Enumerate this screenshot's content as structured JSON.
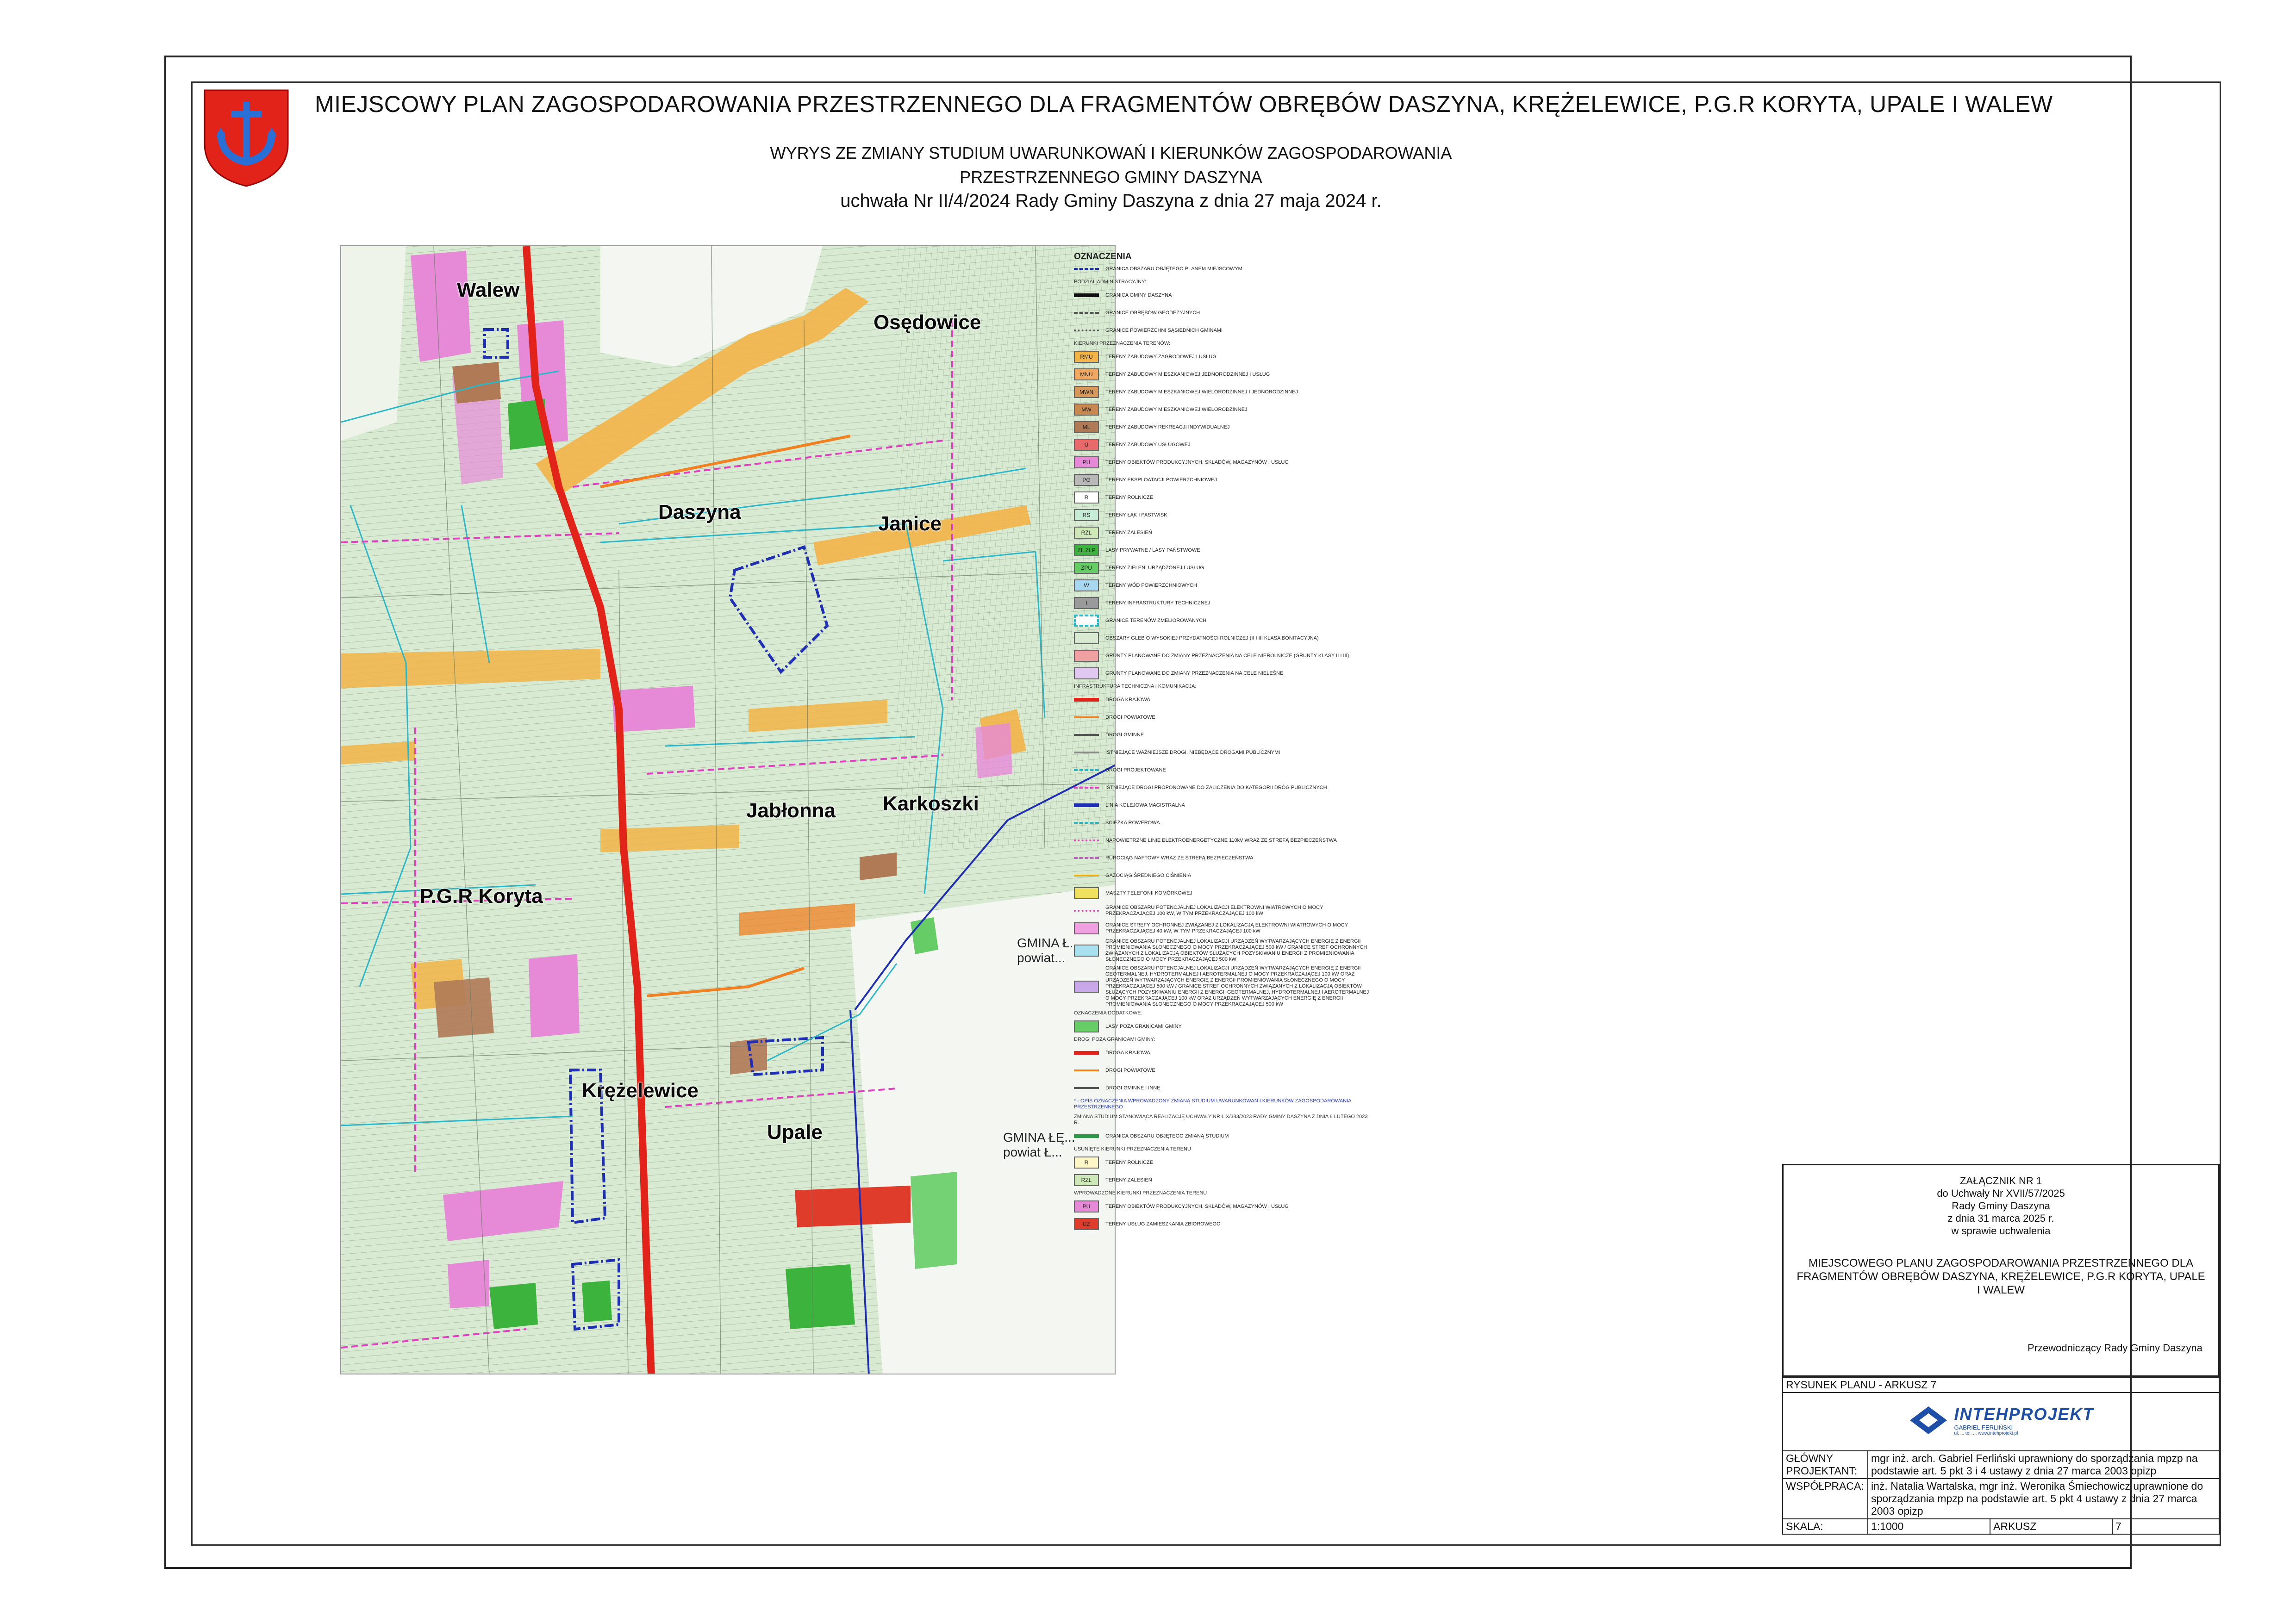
{
  "header": {
    "main_title": "MIEJSCOWY PLAN ZAGOSPODAROWANIA PRZESTRZENNEGO DLA FRAGMENTÓW OBRĘBÓW DASZYNA, KRĘŻELEWICE, P.G.R KORYTA, UPALE I WALEW",
    "subtitle_1": "WYRYS ZE ZMIANY STUDIUM UWARUNKOWAŃ I KIERUNKÓW ZAGOSPODAROWANIA",
    "subtitle_2": "PRZESTRZENNEGO GMINY DASZYNA",
    "subtitle_3": "uchwała Nr II/4/2024 Rady Gminy Daszyna z dnia 27 maja 2024 r."
  },
  "map": {
    "place_labels": {
      "walew": "Walew",
      "osedowice": "Osędowice",
      "daszyna": "Daszyna",
      "janice": "Janice",
      "jablonna": "Jabłonna",
      "karkoszki": "Karkoszki",
      "pgr_koryta": "P.G.R Koryta",
      "krezelewice": "Krężelewice",
      "upale": "Upale",
      "gmina_powiat_1": "GMINA Ł... powiat...",
      "gmina_powiat_2": "GMINA ŁĘ... powiat Ł..."
    },
    "colors": {
      "base_green": "#d9ead3",
      "road_red": "#e2231a",
      "orange_zone": "#f2b447",
      "magenta_zone": "#e68ad8",
      "brown_zone": "#b07a57",
      "forest_green": "#3cb33c",
      "red_zone": "#e03c2b",
      "blue_boundary": "#1f2fb5",
      "cyan_line": "#2ab7c9",
      "pink_dash": "#e040c0"
    }
  },
  "legend": {
    "title": "OZNACZENIA",
    "sections": [
      {
        "heading": "",
        "items": [
          {
            "code": "",
            "label": "GRANICA OBSZARU OBJĘTEGO PLANEM MIEJSCOWYM",
            "color": "#1f2fb5",
            "style": "dash"
          }
        ]
      },
      {
        "heading": "PODZIAŁ ADMINISTRACYJNY:",
        "items": [
          {
            "code": "",
            "label": "GRANICA GMINY DASZYNA",
            "color": "#111111",
            "style": "thick"
          },
          {
            "code": "",
            "label": "GRANICE OBRĘBÓW GEODEZYJNYCH",
            "color": "#555555",
            "style": "dash"
          },
          {
            "code": "",
            "label": "GRANICE POWIERZCHNI SĄSIEDNICH GMINAMI",
            "color": "#555555",
            "style": "dashdot"
          }
        ]
      },
      {
        "heading": "KIERUNKI PRZEZNACZENIA TERENÓW:",
        "items": [
          {
            "code": "RMU",
            "label": "TERENY ZABUDOWY ZAGRODOWEJ I USŁUG",
            "color": "#f2b447",
            "style": "fill"
          },
          {
            "code": "MNU",
            "label": "TERENY ZABUDOWY MIESZKANIOWEJ JEDNORODZINNEJ I USŁUG",
            "color": "#f0a860",
            "style": "fill"
          },
          {
            "code": "MWN",
            "label": "TERENY ZABUDOWY MIESZKANIOWEJ WIELORODZINNEJ I JEDNORODZINNEJ",
            "color": "#d8985a",
            "style": "fill"
          },
          {
            "code": "MW",
            "label": "TERENY ZABUDOWY MIESZKANIOWEJ WIELORODZINNEJ",
            "color": "#c88850",
            "style": "fill"
          },
          {
            "code": "ML",
            "label": "TERENY ZABUDOWY REKREACJI INDYWIDUALNEJ",
            "color": "#b07a57",
            "style": "fill"
          },
          {
            "code": "U",
            "label": "TERENY ZABUDOWY USŁUGOWEJ",
            "color": "#e86a6a",
            "style": "fill"
          },
          {
            "code": "PU",
            "label": "TERENY OBIEKTÓW PRODUKCYJNYCH, SKŁADÓW, MAGAZYNÓW I USŁUG",
            "color": "#e68ad8",
            "style": "fill"
          },
          {
            "code": "PG",
            "label": "TERENY EKSPLOATACJI POWIERZCHNIOWEJ",
            "color": "#b8b8b8",
            "style": "fill"
          },
          {
            "code": "R",
            "label": "TERENY ROLNICZE",
            "color": "#ffffff",
            "style": "fill"
          },
          {
            "code": "RS",
            "label": "TERENY ŁĄK I PASTWISK",
            "color": "#c6ecd6",
            "style": "fill"
          },
          {
            "code": "RZL",
            "label": "TERENY ZALESIEŃ",
            "color": "#cfe8b8",
            "style": "fill"
          },
          {
            "code": "ZL ZLP",
            "label": "LASY PRYWATNE / LASY PAŃSTWOWE",
            "color": "#3cb33c",
            "style": "fill"
          },
          {
            "code": "ZPU",
            "label": "TERENY ZIELENI URZĄDZONEJ I USŁUG",
            "color": "#66cc66",
            "style": "fill"
          },
          {
            "code": "W",
            "label": "TERENY WÓD POWIERZCHNIOWYCH",
            "color": "#a8d8f0",
            "style": "fill"
          },
          {
            "code": "I",
            "label": "TERENY INFRASTRUKTURY TECHNICZNEJ",
            "color": "#9a9a9a",
            "style": "fill"
          },
          {
            "code": "",
            "label": "GRANICE TERENÓW ZMELIOROWANYCH",
            "color": "#2ab7c9",
            "style": "outline"
          },
          {
            "code": "",
            "label": "OBSZARY GLEB O WYSOKIEJ PRZYDATNOŚCI ROLNICZEJ (II I III KLASA BONITACYJNA)",
            "color": "#d9ead3",
            "style": "fill"
          },
          {
            "code": "",
            "label": "GRUNTY PLANOWANE DO ZMIANY PRZEZNACZENIA NA CELE NIEROLNICZE (GRUNTY KLASY II I III)",
            "color": "#f0a0a0",
            "style": "fill"
          },
          {
            "code": "",
            "label": "GRUNTY PLANOWANE DO ZMIANY PRZEZNACZENIA NA CELE NIELEŚNE",
            "color": "#e0c8f0",
            "style": "fill"
          }
        ]
      },
      {
        "heading": "INFRASTRUKTURA TECHNICZNA I KOMUNIKACJA:",
        "items": [
          {
            "code": "",
            "label": "DROGA KRAJOWA",
            "color": "#e2231a",
            "style": "thick"
          },
          {
            "code": "",
            "label": "DROGI POWIATOWE",
            "color": "#f08020",
            "style": "line"
          },
          {
            "code": "",
            "label": "DROGI GMINNE",
            "color": "#555555",
            "style": "line"
          },
          {
            "code": "",
            "label": "ISTNIEJĄCE WAŻNIEJSZE DROGI, NIEBĘDĄCE DROGAMI PUBLICZNYMI",
            "color": "#888888",
            "style": "line"
          },
          {
            "code": "",
            "label": "DROGI PROJEKTOWANE",
            "color": "#2ab7c9",
            "style": "dash"
          },
          {
            "code": "",
            "label": "ISTNIEJĄCE DROGI PROPONOWANE DO ZALICZENIA DO KATEGORII DRÓG PUBLICZNYCH",
            "color": "#e040c0",
            "style": "dash"
          },
          {
            "code": "",
            "label": "LINIA KOLEJOWA MAGISTRALNA",
            "color": "#1f2fb5",
            "style": "thick"
          },
          {
            "code": "",
            "label": "ŚCIEŻKA ROWEROWA",
            "color": "#2ab7c9",
            "style": "dash"
          },
          {
            "code": "",
            "label": "NAPOWIETRZNE LINIE ELEKTROENERGETYCZNE 110kV WRAZ ZE STREFĄ BEZPIECZEŃSTWA",
            "color": "#e040c0",
            "style": "dashdot"
          },
          {
            "code": "",
            "label": "RUROCIĄG NAFTOWY WRAZ ZE STREFĄ BEZPIECZEŃSTWA",
            "color": "#c060c0",
            "style": "dash"
          },
          {
            "code": "",
            "label": "GAZOCIĄG ŚREDNIEGO CIŚNIENIA",
            "color": "#e0b020",
            "style": "line"
          },
          {
            "code": "",
            "label": "MASZTY TELEFONII KOMÓRKOWEJ",
            "color": "#f0e060",
            "style": "fill"
          },
          {
            "code": "",
            "label": "GRANICE OBSZARU POTENCJALNEJ LOKALIZACJI ELEKTROWNI WIATROWYCH O MOCY PRZEKRACZAJĄCEJ 100 kW, W TYM PRZEKRACZAJĄCEJ 100 kW",
            "color": "#e040c0",
            "style": "dashdot"
          },
          {
            "code": "",
            "label": "GRANICE STREFY OCHRONNEJ ZWIĄZANEJ Z LOKALIZACJĄ ELEKTROWNI WIATROWYCH O MOCY PRZEKRACZAJĄCEJ 40 kW, W TYM PRZEKRACZAJĄCEJ 100 kW",
            "color": "#f0a0e0",
            "style": "fill"
          },
          {
            "code": "",
            "label": "GRANICE OBSZARU POTENCJALNEJ LOKALIZACJI URZĄDZEŃ WYTWARZAJĄCYCH ENERGIĘ Z ENERGII PROMIENIOWANIA SŁONECZNEGO O MOCY PRZEKRACZAJĄCEJ 500 kW / GRANICE STREF OCHRONNYCH ZWIĄZANYCH Z LOKALIZACJĄ OBIEKTÓW SŁUŻĄCYCH POZYSKIWANIU ENERGII Z PROMIENIOWANIA SŁONECZNEGO O MOCY PRZEKRACZAJĄCEJ 500 kW",
            "color": "#a8e0f0",
            "style": "fill"
          },
          {
            "code": "",
            "label": "GRANICE OBSZARU POTENCJALNEJ LOKALIZACJI URZĄDZEŃ WYTWARZAJĄCYCH ENERGIĘ Z ENERGII GEOTERMALNEJ, HYDROTERMALNEJ I AEROTERMALNEJ O MOCY PRZEKRACZAJĄCEJ 100 kW ORAZ URZĄDZEŃ WYTWARZAJĄCYCH ENERGIĘ Z ENERGII PROMIENIOWANIA SŁONECZNEGO O MOCY PRZEKRACZAJĄCEJ 500 kW / GRANICE STREF OCHRONNYCH ZWIĄZANYCH Z LOKALIZACJĄ OBIEKTÓW SŁUŻĄCYCH POZYSKIWANIU ENERGII Z ENERGII GEOTERMALNEJ, HYDROTERMALNEJ I AEROTERMALNEJ O MOCY PRZEKRACZAJĄCEJ 100 kW ORAZ URZĄDZEŃ WYTWARZAJĄCYCH ENERGIĘ Z ENERGII PROMIENIOWANIA SŁONECZNEGO O MOCY PRZEKRACZAJĄCEJ 500 kW",
            "color": "#c8a8e8",
            "style": "fill"
          }
        ]
      },
      {
        "heading": "OZNACZENIA DODATKOWE:",
        "items": [
          {
            "code": "",
            "label": "LASY POZA GRANICAMI GMINY",
            "color": "#66cc66",
            "style": "fill"
          }
        ]
      },
      {
        "heading": "DROGI POZA GRANICAMI GMINY:",
        "items": [
          {
            "code": "",
            "label": "DROGA KRAJOWA",
            "color": "#e2231a",
            "style": "thick"
          },
          {
            "code": "",
            "label": "DROGI POWIATOWE",
            "color": "#f08020",
            "style": "line"
          },
          {
            "code": "",
            "label": "DROGI GMINNE I INNE",
            "color": "#555555",
            "style": "line"
          }
        ]
      }
    ],
    "note": "* - OPIS OZNACZENIA WPROWADZONY ZMIANĄ STUDIUM UWARUNKOWAŃ I KIERUNKÓW ZAGOSPODAROWANIA PRZESTRZENNEGO",
    "sections_2": [
      {
        "heading": "ZMIANA STUDIUM STANOWIĄCA REALIZACJĘ UCHWAŁY NR LIX/383/2023 RADY GMINY DASZYNA Z DNIA 8 LUTEGO 2023 R.",
        "items": [
          {
            "code": "",
            "label": "GRANICA OBSZARU OBJĘTEGO ZMIANĄ STUDIUM",
            "color": "#2e9a4a",
            "style": "thick"
          }
        ]
      },
      {
        "heading": "USUNIĘTE KIERUNKI PRZEZNACZENIA TERENU",
        "items": [
          {
            "code": "R",
            "label": "TERENY ROLNICZE",
            "color": "#fff6c8",
            "style": "fill"
          },
          {
            "code": "RZL",
            "label": "TERENY ZALESIEŃ",
            "color": "#cfe8b8",
            "style": "fill"
          }
        ]
      },
      {
        "heading": "WPROWADZONE KIERUNKI PRZEZNACZENIA TERENU",
        "items": [
          {
            "code": "PU",
            "label": "TERENY OBIEKTÓW PRODUKCYJNYCH, SKŁADÓW, MAGAZYNÓW I USŁUG",
            "color": "#e68ad8",
            "style": "fill"
          },
          {
            "code": "UZ",
            "label": "TERENY USŁUG ZAMIESZKANIA ZBIOROWEGO",
            "color": "#e03c2b",
            "style": "fill"
          }
        ]
      }
    ]
  },
  "title_block": {
    "zalacznik": [
      "ZAŁĄCZNIK NR 1",
      "do Uchwały Nr XVII/57/2025",
      "Rady Gminy Daszyna",
      "z dnia 31 marca 2025 r.",
      "w sprawie uchwalenia"
    ],
    "plan_title": "MIEJSCOWEGO PLANU ZAGOSPODAROWANIA PRZESTRZENNEGO DLA FRAGMENTÓW OBRĘBÓW DASZYNA, KRĘŻELEWICE, P.G.R KORYTA, UPALE I WALEW",
    "chair": "Przewodniczący Rady Gminy Daszyna",
    "sheet_label": "RYSUNEK PLANU - ARKUSZ 7",
    "logo_name": "INTEHPROJEKT",
    "logo_sub": "GABRIEL FERLIŃSKI",
    "logo_lines": "ul. ... tel. ... www.intehprojekt.pl",
    "main_designer_label": "GŁÓWNY PROJEKTANT:",
    "main_designer_text": "mgr inż. arch. Gabriel Ferliński uprawniony do sporządzania mpzp na podstawie art. 5 pkt 3 i 4 ustawy z dnia 27 marca 2003 opizp",
    "cooperation_label": "WSPÓŁPRACA:",
    "cooperation_text": "inż. Natalia Wartalska, mgr inż. Weronika Śmiechowicz uprawnione do sporządzania mpzp na podstawie art. 5 pkt 4 ustawy z dnia 27 marca 2003 opizp",
    "scale_label": "SKALA:",
    "scale_value": "1:1000",
    "sheet_word": "ARKUSZ",
    "sheet_number": "7"
  }
}
